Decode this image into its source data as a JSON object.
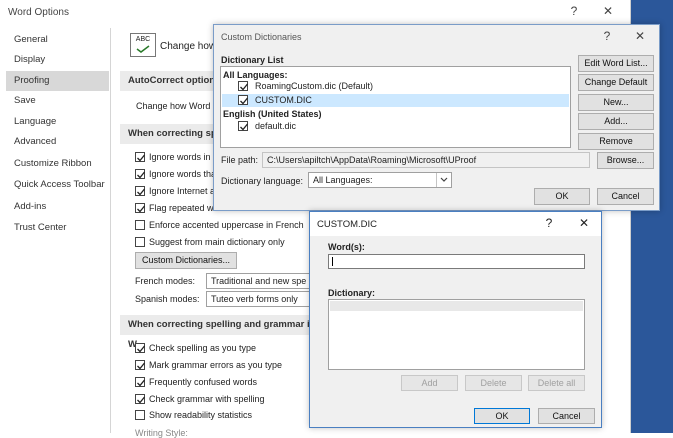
{
  "word_options": {
    "title": "Word Options",
    "help_glyph": "?",
    "close_glyph": "✕",
    "nav": [
      "General",
      "Display",
      "Proofing",
      "Save",
      "Language",
      "Advanced",
      "Customize Ribbon",
      "Quick Access Toolbar",
      "Add-ins",
      "Trust Center"
    ],
    "header_label": "Change how",
    "abc_label": "ABC",
    "sections": {
      "autocorrect": "AutoCorrect options",
      "autocorrect_desc": "Change how Word c",
      "correcting_office": "When correcting spe",
      "correcting_word": "When correcting spelling and grammar in W"
    },
    "office_options": [
      "Ignore words in",
      "Ignore words tha",
      "Ignore Internet a",
      "Flag repeated wo",
      "Enforce accented uppercase in French",
      "Suggest from main dictionary only"
    ],
    "custom_dict_button": "Custom Dictionaries...",
    "french_modes_label": "French modes:",
    "french_modes_value": "Traditional and new spe",
    "spanish_modes_label": "Spanish modes:",
    "spanish_modes_value": "Tuteo verb forms only",
    "word_options_checks": [
      "Check spelling as you type",
      "Mark grammar errors as you type",
      "Frequently confused words",
      "Check grammar with spelling",
      "Show readability statistics"
    ],
    "writing_style_label": "Writing Style:"
  },
  "custom_dictionaries": {
    "title": "Custom Dictionaries",
    "help_glyph": "?",
    "close_glyph": "✕",
    "list_label": "Dictionary List",
    "group_all": "All Languages:",
    "items_all": [
      "RoamingCustom.dic (Default)",
      "CUSTOM.DIC"
    ],
    "group_en": "English (United States)",
    "items_en": [
      "default.dic"
    ],
    "buttons": [
      "Edit Word List...",
      "Change Default",
      "New...",
      "Add...",
      "Remove",
      "Browse..."
    ],
    "file_path_label": "File path:",
    "file_path_value": "C:\\Users\\apiltch\\AppData\\Roaming\\Microsoft\\UProof",
    "dict_language_label": "Dictionary language:",
    "dict_language_value": "All Languages:",
    "ok_label": "OK",
    "cancel_label": "Cancel"
  },
  "custom_dic": {
    "title": "CUSTOM.DIC",
    "help_glyph": "?",
    "close_glyph": "✕",
    "words_label": "Word(s):",
    "words_value": "",
    "dictionary_label": "Dictionary:",
    "add_label": "Add",
    "delete_label": "Delete",
    "delete_all_label": "Delete all",
    "ok_label": "OK",
    "cancel_label": "Cancel"
  },
  "colors": {
    "dialog_border": "#7a9cc8",
    "selection": "#cce8ff",
    "nav_active": "#d8d8d8",
    "section_bg": "#ebebeb"
  }
}
